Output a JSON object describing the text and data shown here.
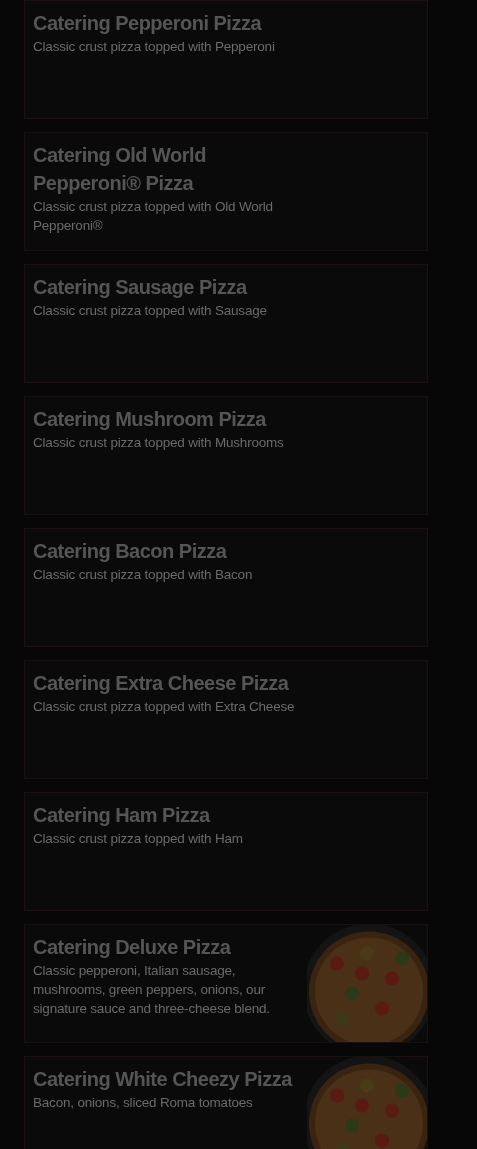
{
  "menu_items": [
    {
      "title": "Catering Pepperoni Pizza",
      "description": "Classic crust pizza topped with Pepperoni",
      "photo": false
    },
    {
      "title": "Catering Old World Pepperoni® Pizza",
      "description": "Classic crust pizza topped with Old World Pepperoni®",
      "photo": false
    },
    {
      "title": "Catering Sausage Pizza",
      "description": "Classic crust pizza topped with Sausage",
      "photo": false
    },
    {
      "title": "Catering Mushroom Pizza",
      "description": "Classic crust pizza topped with Mushrooms",
      "photo": false
    },
    {
      "title": "Catering Bacon Pizza",
      "description": "Classic crust pizza topped with Bacon",
      "photo": false
    },
    {
      "title": "Catering Extra Cheese Pizza",
      "description": "Classic crust pizza topped with Extra Cheese",
      "photo": false
    },
    {
      "title": "Catering Ham Pizza",
      "description": "Classic crust pizza topped with Ham",
      "photo": false
    },
    {
      "title": "Catering Deluxe Pizza",
      "description": "Classic pepperoni, Italian sausage, mushrooms, green peppers, onions, our signature sauce and three-cheese blend.",
      "photo": true
    },
    {
      "title": "Catering White Cheezy Pizza",
      "description": "Bacon, onions, sliced Roma tomatoes",
      "photo": true
    }
  ]
}
